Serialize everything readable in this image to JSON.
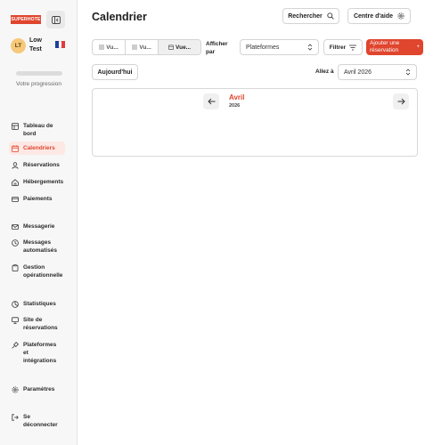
{
  "brand": {
    "logo_text": "SUPERHOTE",
    "accent": "#e0452e"
  },
  "user": {
    "initials": "LT",
    "name": "Low Test",
    "language_flag": "fr-flag"
  },
  "progress": {
    "label": "Votre progression",
    "value": 0
  },
  "sidebar": {
    "items": [
      {
        "label": "Tableau de bord",
        "icon": "dashboard-icon"
      },
      {
        "label": "Calendriers",
        "icon": "calendar-icon",
        "active": true
      },
      {
        "label": "Réservations",
        "icon": "user-icon"
      },
      {
        "label": "Hébergements",
        "icon": "home-icon"
      },
      {
        "label": "Paiements",
        "icon": "card-icon"
      },
      {
        "label": "Messagerie",
        "icon": "mail-icon"
      },
      {
        "label": "Messages automatisés",
        "icon": "clock-icon"
      },
      {
        "label": "Gestion opérationnelle",
        "icon": "clipboard-icon"
      },
      {
        "label": "Statistiques",
        "icon": "chart-icon"
      },
      {
        "label": "Site de réservations",
        "icon": "monitor-icon"
      },
      {
        "label": "Plateformes et intégrations",
        "icon": "plug-icon"
      },
      {
        "label": "Paramètres",
        "icon": "gear-icon"
      },
      {
        "label": "Se déconnecter",
        "icon": "logout-icon"
      }
    ]
  },
  "header": {
    "title": "Calendrier",
    "search_label": "Rechercher",
    "help_label": "Centre d'aide"
  },
  "toolbar": {
    "view_tabs": [
      {
        "label": "Vu..."
      },
      {
        "label": "Vu..."
      },
      {
        "label": "Vue...",
        "active": true
      }
    ],
    "display_by_label": "Afficher par",
    "display_by_value": "Plateformes",
    "filter_label": "Filtrer",
    "add_reservation_label": "Ajouter une réservation",
    "today_label": "Aujourd'hui",
    "goto_label": "Allez à",
    "goto_value": "Avril 2026"
  },
  "calendar": {
    "month": "Avril",
    "year": "2026"
  }
}
